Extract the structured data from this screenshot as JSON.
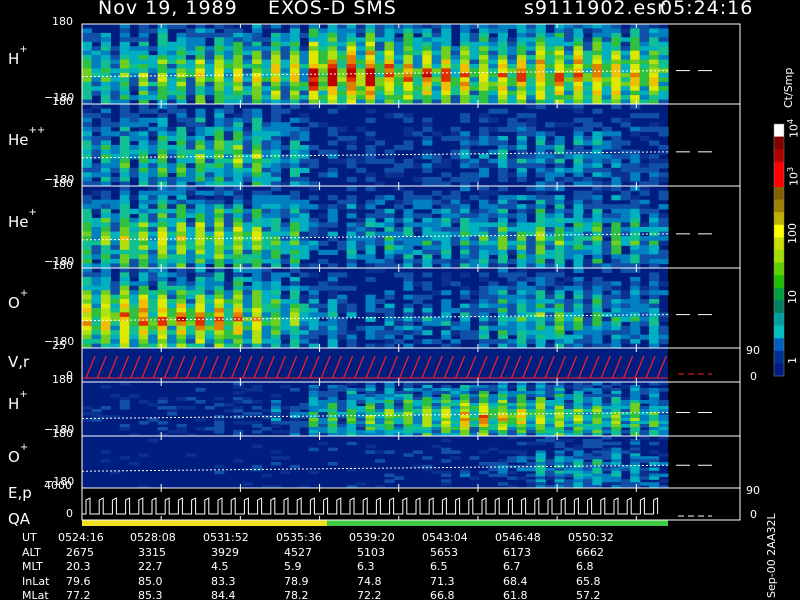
{
  "header": {
    "date": "Nov 19, 1989",
    "mission": "EXOS-D SMS",
    "file": "s9111902.esr",
    "time": "05:24:16"
  },
  "panels": [
    {
      "key": "hp",
      "base": "H",
      "sup": "+",
      "top": "180",
      "bottom": "−180",
      "right": ""
    },
    {
      "key": "hepp",
      "base": "He",
      "sup": "++",
      "top": "180",
      "bottom": "−180",
      "right": ""
    },
    {
      "key": "hep",
      "base": "He",
      "sup": "+",
      "top": "180",
      "bottom": "−180",
      "right": ""
    },
    {
      "key": "op",
      "base": "O",
      "sup": "+",
      "top": "180",
      "bottom": "−180",
      "right": ""
    },
    {
      "key": "vr",
      "base": "V,r",
      "sup": "",
      "top": "25",
      "bottom": "0",
      "right_top": "90",
      "right_bottom": "0"
    },
    {
      "key": "hp2",
      "base": "H",
      "sup": "+",
      "top": "180",
      "bottom": "−180",
      "right": ""
    },
    {
      "key": "op2",
      "base": "O",
      "sup": "+",
      "top": "180",
      "bottom": "−180",
      "right": ""
    },
    {
      "key": "ep",
      "base": "E,p",
      "sup": "",
      "top": "4000",
      "bottom": "0",
      "right_top": "90",
      "right_bottom": "0"
    }
  ],
  "qa_label": "QA",
  "colorbar": {
    "unit": "Ct/Smp",
    "labels": [
      {
        "base": "10",
        "sup": "4"
      },
      {
        "base": "10",
        "sup": "3"
      },
      {
        "base": "100",
        "sup": ""
      },
      {
        "base": "10",
        "sup": ""
      },
      {
        "base": "1",
        "sup": ""
      }
    ],
    "colors": [
      "#ffffff",
      "#800000",
      "#b00000",
      "#ff0000",
      "#ff0000",
      "#806000",
      "#a08000",
      "#c0b000",
      "#ffff00",
      "#c8e000",
      "#a0e000",
      "#60d000",
      "#20c000",
      "#00a040",
      "#008060",
      "#00a0a0",
      "#00c0c0",
      "#0060c0",
      "#003090",
      "#001e80"
    ]
  },
  "side_note": "Sep-00 2AA32L",
  "orbit": {
    "rows": [
      {
        "label": "UT",
        "values": [
          "0524:16",
          "0528:08",
          "0531:52",
          "0535:36",
          "0539:20",
          "0543:04",
          "0546:48",
          "0550:32"
        ]
      },
      {
        "label": "ALT",
        "values": [
          "2675",
          "3315",
          "3929",
          "4527",
          "5103",
          "5653",
          "6173",
          "6662"
        ]
      },
      {
        "label": "MLT",
        "values": [
          "20.3",
          "22.7",
          "4.5",
          "5.9",
          "6.3",
          "6.5",
          "6.7",
          "6.8"
        ]
      },
      {
        "label": "InLat",
        "values": [
          "79.6",
          "85.0",
          "83.3",
          "78.9",
          "74.8",
          "71.3",
          "68.4",
          "65.8"
        ]
      },
      {
        "label": "MLat",
        "values": [
          "77.2",
          "85.3",
          "84.4",
          "78.2",
          "72.2",
          "66.8",
          "61.8",
          "57.2"
        ]
      }
    ]
  },
  "chart_data": {
    "type": "heatmap",
    "title": "Nov 19, 1989   EXOS-D SMS   s9111902.esr   05:24:16",
    "x": [
      "0524:16",
      "0528:08",
      "0531:52",
      "0535:36",
      "0539:20",
      "0543:04",
      "0546:48",
      "0550:32"
    ],
    "xlabel": "UT",
    "color_scale": {
      "label": "Ct/Smp",
      "range": [
        1,
        10000
      ],
      "log": true
    },
    "series": [
      {
        "name": "H+",
        "ylim": [
          -180,
          180
        ],
        "relative_intensity": [
          0.45,
          0.5,
          0.55,
          0.6,
          0.6,
          0.65,
          0.9,
          0.95,
          0.8,
          0.75,
          0.7,
          0.75,
          0.8,
          0.8,
          0.75,
          0.7
        ]
      },
      {
        "name": "He++",
        "ylim": [
          -180,
          180
        ],
        "relative_intensity": [
          0.35,
          0.4,
          0.45,
          0.5,
          0.55,
          0.35,
          0.15,
          0.1,
          0.1,
          0.15,
          0.2,
          0.25,
          0.3,
          0.3,
          0.25,
          0.2
        ]
      },
      {
        "name": "He+",
        "ylim": [
          -180,
          180
        ],
        "relative_intensity": [
          0.5,
          0.55,
          0.6,
          0.6,
          0.6,
          0.45,
          0.2,
          0.3,
          0.35,
          0.35,
          0.4,
          0.45,
          0.5,
          0.45,
          0.4,
          0.35
        ]
      },
      {
        "name": "O+",
        "ylim": [
          -180,
          180
        ],
        "relative_intensity": [
          0.7,
          0.75,
          0.75,
          0.75,
          0.7,
          0.5,
          0.3,
          0.2,
          0.2,
          0.25,
          0.3,
          0.4,
          0.45,
          0.4,
          0.35,
          0.3
        ]
      },
      {
        "name": "H+ (2)",
        "ylim": [
          -180,
          180
        ],
        "relative_intensity": [
          0.05,
          0.05,
          0.08,
          0.1,
          0.15,
          0.2,
          0.4,
          0.5,
          0.55,
          0.6,
          0.7,
          0.65,
          0.6,
          0.55,
          0.5,
          0.45
        ]
      },
      {
        "name": "O+ (2)",
        "ylim": [
          -180,
          180
        ],
        "relative_intensity": [
          0.02,
          0.02,
          0.02,
          0.03,
          0.03,
          0.04,
          0.04,
          0.05,
          0.05,
          0.08,
          0.1,
          0.15,
          0.3,
          0.35,
          0.3,
          0.25
        ]
      }
    ],
    "line_panels": [
      {
        "name": "V,r",
        "ylim": [
          0,
          25
        ],
        "right_ylim": [
          0,
          90
        ]
      },
      {
        "name": "E,p",
        "ylim": [
          0,
          4000
        ],
        "right_ylim": [
          0,
          90
        ]
      }
    ]
  }
}
